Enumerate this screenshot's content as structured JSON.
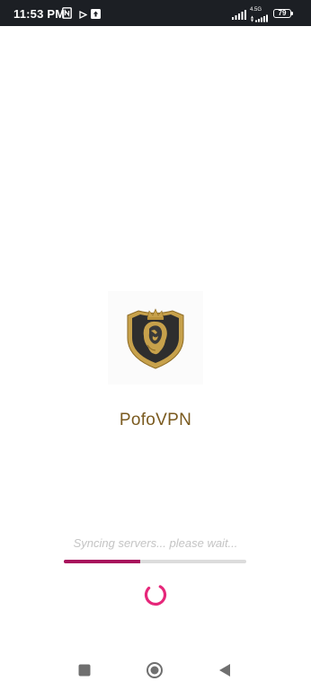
{
  "status_bar": {
    "time": "11:53 PM",
    "network_label": "4.5G",
    "battery_level": "79",
    "icons": [
      "nfc-icon",
      "play-icon",
      "upload-icon",
      "signal-icon",
      "wifi-signal-icon",
      "battery-icon"
    ]
  },
  "splash": {
    "app_name": "PofoVPN",
    "logo_icon": "lion-shield-logo"
  },
  "loading": {
    "status_text": "Syncing servers... please wait...",
    "progress_fraction": 0.42,
    "progress_color": "#a8105c",
    "spinner_color": "#e6277a"
  },
  "nav_bar": {
    "buttons": [
      "recents-button",
      "home-button",
      "back-button"
    ]
  }
}
